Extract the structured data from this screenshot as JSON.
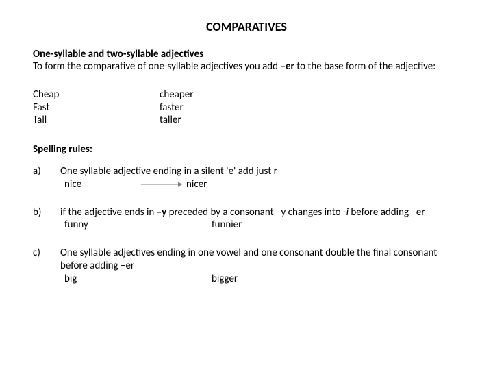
{
  "title": "COMPARATIVES",
  "section1": {
    "heading": "One-syllable and two-syllable adjectives",
    "intro_a": "To form the comparative of one-syllable adjectives you add ",
    "intro_suffix": "–er",
    "intro_b": " to the base form of the adjective:"
  },
  "examples": [
    {
      "base": "Cheap",
      "comp": "cheaper"
    },
    {
      "base": "Fast",
      "comp": "faster"
    },
    {
      "base": "Tall",
      "comp": "taller"
    }
  ],
  "spelling": {
    "heading_underlined": "Spelling rules",
    "heading_tail": ":"
  },
  "rules": {
    "a": {
      "label": "a)",
      "text": "One syllable adjective ending in a silent 'e' add just r",
      "base": "nice",
      "comp": "nicer"
    },
    "b": {
      "label": "b)",
      "text_a": "if the adjective ends in ",
      "y_suffix": "–y",
      "text_b": " preceded by a consonant –y changes into ",
      "i_suffix": "-i",
      "text_c": " before adding –er",
      "base": "funny",
      "comp": "funnier"
    },
    "c": {
      "label": "c)",
      "text": "One syllable adjectives ending in one vowel and one consonant double the final consonant before adding –er",
      "base": "big",
      "comp": "bigger"
    }
  }
}
